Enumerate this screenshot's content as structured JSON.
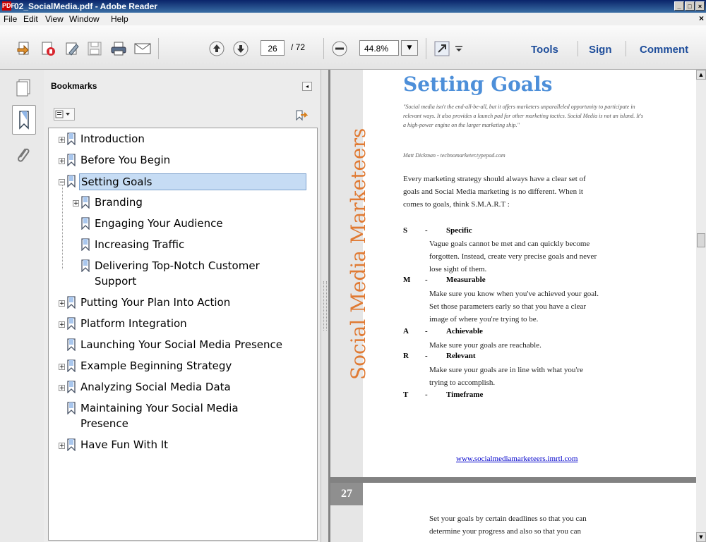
{
  "window": {
    "title": "02_SocialMedia.pdf - Adobe Reader",
    "app_icon": "PDF",
    "buttons": {
      "minimize": "_",
      "maximize": "□",
      "close": "×"
    },
    "close_doc": "×"
  },
  "menu": [
    "File",
    "Edit",
    "View",
    "Window",
    "Help"
  ],
  "toolbar": {
    "page_number": "26",
    "page_count": "/ 72",
    "zoom": "44.8%",
    "tools_label": "Tools",
    "sign_label": "Sign",
    "comment_label": "Comment",
    "icons": [
      "create-pdf-icon",
      "edit-pdf-icon",
      "sign-edit-icon",
      "save-icon",
      "print-icon",
      "email-icon",
      "previous-page-icon",
      "next-page-icon",
      "zoom-out-icon",
      "zoom-dropdown-icon",
      "fit-page-icon",
      "more-tools-icon"
    ]
  },
  "sidebar": {
    "panels": [
      "pages-icon",
      "bookmarks-icon",
      "attachments-icon"
    ],
    "bookmarks_title": "Bookmarks",
    "options_icon": "bookmark-options-icon",
    "items": [
      {
        "label": "Introduction",
        "expander": "+"
      },
      {
        "label": "Before You Begin",
        "expander": "+"
      },
      {
        "label": "Setting Goals",
        "expander": "−",
        "selected": true
      },
      {
        "label": "Branding",
        "expander": "+"
      },
      {
        "label": "Engaging Your Audience",
        "expander": ""
      },
      {
        "label": "Increasing Traffic",
        "expander": ""
      },
      {
        "label": "Delivering Top-Notch Customer",
        "label2": "Support",
        "expander": ""
      },
      {
        "label": "Putting Your Plan Into Action",
        "expander": "+"
      },
      {
        "label": "Platform Integration",
        "expander": "+"
      },
      {
        "label": "Launching Your Social Media Presence",
        "expander": ""
      },
      {
        "label": "Example Beginning Strategy",
        "expander": "+"
      },
      {
        "label": "Analyzing Social Media Data",
        "expander": "+"
      },
      {
        "label": "Maintaining Your Social Media",
        "label2": "Presence",
        "expander": ""
      },
      {
        "label": "Have Fun With It",
        "expander": "+"
      }
    ]
  },
  "document": {
    "vertical_title": "Social Media Marketeers",
    "heading": "Setting Goals",
    "quote": "\"Social media isn't the end-all-be-all, but it offers marketers unparalleled opportunity to participate in relevant ways. It also provides a launch pad for other marketing tactics. Social Media is not an island. It's a high-power engine on the larger marketing ship.\"",
    "quote_author": "Matt Dickman - technomarketer.typepad.com",
    "intro_lines": [
      "Every marketing strategy should always have a clear set of",
      "goals and Social Media marketing is no different. When it",
      "comes to goals, think S.M.A.R.T :"
    ],
    "smart": [
      {
        "letter": "S",
        "dash": "-",
        "word": "Specific",
        "desc": [
          "Vague goals cannot be met and can quickly become",
          "forgotten. Instead, create very precise goals and never",
          "lose sight of them."
        ]
      },
      {
        "letter": "M",
        "dash": "-",
        "word": "Measurable",
        "desc": [
          "Make sure you know when you've achieved your goal.",
          "Set those parameters early so that you have a clear",
          "image of where you're trying to be."
        ]
      },
      {
        "letter": "A",
        "dash": "-",
        "word": "Achievable",
        "desc": [
          "Make sure your goals are reachable."
        ]
      },
      {
        "letter": "R",
        "dash": "-",
        "word": "Relevant",
        "desc": [
          "Make sure your goals are in line with what you're",
          "trying to accomplish."
        ]
      },
      {
        "letter": "T",
        "dash": "-",
        "word": "Timeframe",
        "desc": []
      }
    ],
    "url": "www.socialmediamarketeers.imrtl.com",
    "next_page_number": "27",
    "next_page_lines": [
      "Set your goals by certain deadlines so that you can",
      "determine your progress and also so that you can"
    ]
  },
  "colors": {
    "heading": "#4d8fd9",
    "vertical_title": "#e07a33",
    "toolbar_link": "#1f4e9b",
    "selection": "#c6dcf4"
  }
}
